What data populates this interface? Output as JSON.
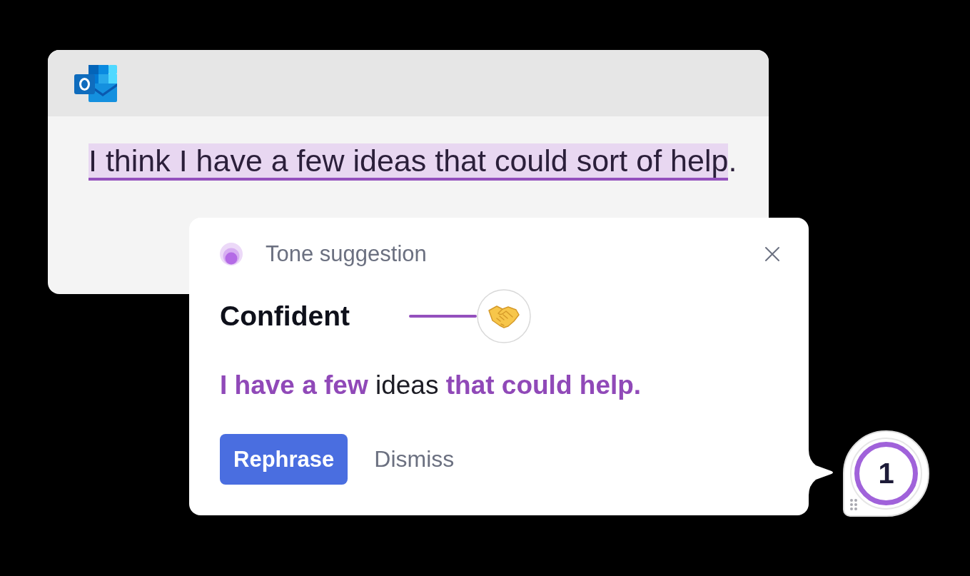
{
  "email_window": {
    "draft": {
      "flagged_text": "I think I have a few ideas that could sort of help",
      "rest": "."
    }
  },
  "suggestion_card": {
    "label": "Tone suggestion",
    "tone": "Confident",
    "rewrite": "**I have a few** ideas **that could help.**",
    "buttons": [
      {
        "label": "Rephrase",
        "kind": "primary"
      },
      {
        "label": "Dismiss",
        "kind": "text"
      }
    ]
  },
  "assistant_badge": {
    "count": "1"
  }
}
